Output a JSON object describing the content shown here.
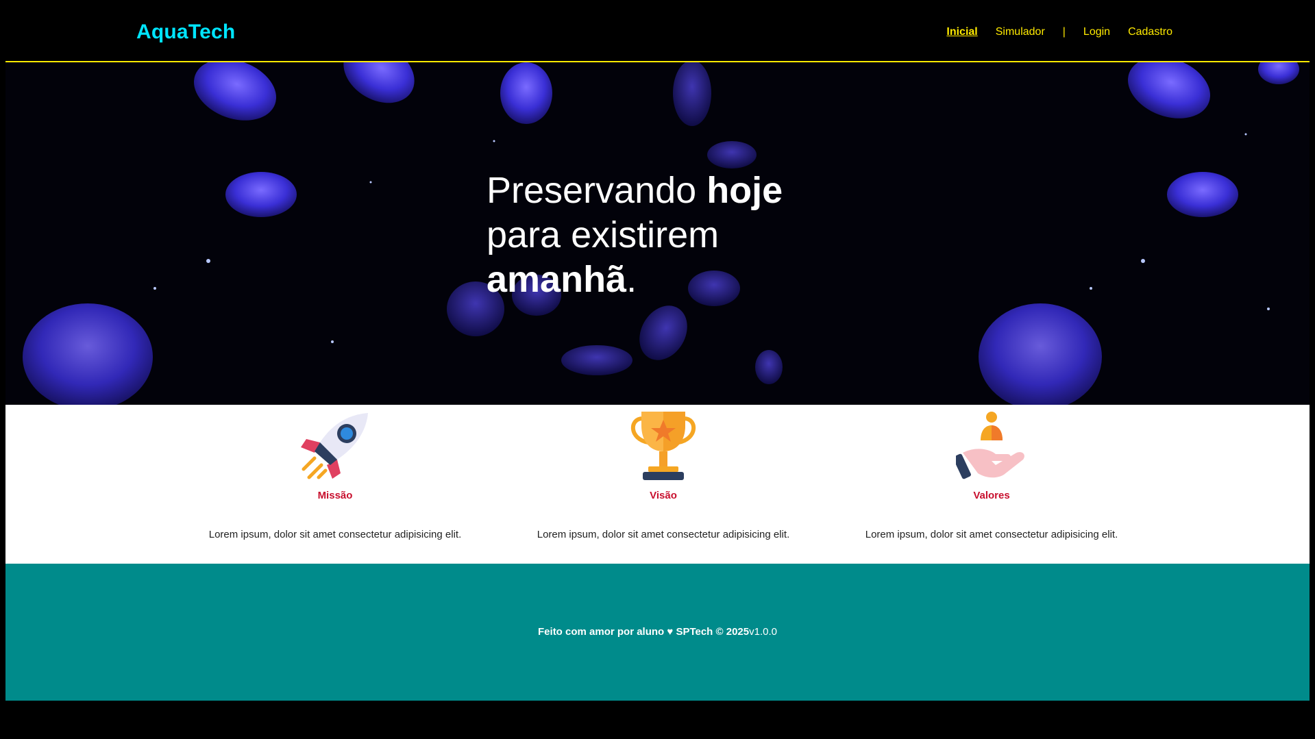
{
  "brand": {
    "logo": "AquaTech",
    "logo_color": "#00e5ff"
  },
  "nav": {
    "items": [
      {
        "label": "Inicial",
        "active": true
      },
      {
        "label": "Simulador",
        "active": false
      },
      {
        "label": "|",
        "separator": true
      },
      {
        "label": "Login",
        "active": false
      },
      {
        "label": "Cadastro",
        "active": false
      }
    ],
    "color": "#ffea00"
  },
  "hero": {
    "line1_a": "Preservando ",
    "line1_b": "hoje",
    "line2": "para existirem",
    "line3_a": "amanhã",
    "line3_b": "."
  },
  "features": [
    {
      "icon": "rocket-icon",
      "title": "Missão",
      "text": "Lorem ipsum, dolor sit amet consectetur adipisicing elit."
    },
    {
      "icon": "trophy-icon",
      "title": "Visão",
      "text": "Lorem ipsum, dolor sit amet consectetur adipisicing elit."
    },
    {
      "icon": "hand-person-icon",
      "title": "Valores",
      "text": "Lorem ipsum, dolor sit amet consectetur adipisicing elit."
    }
  ],
  "footer": {
    "text": "Feito com amor por aluno ♥ SPTech © 2025",
    "version": "v1.0.0",
    "bg_color": "#008b8b"
  }
}
